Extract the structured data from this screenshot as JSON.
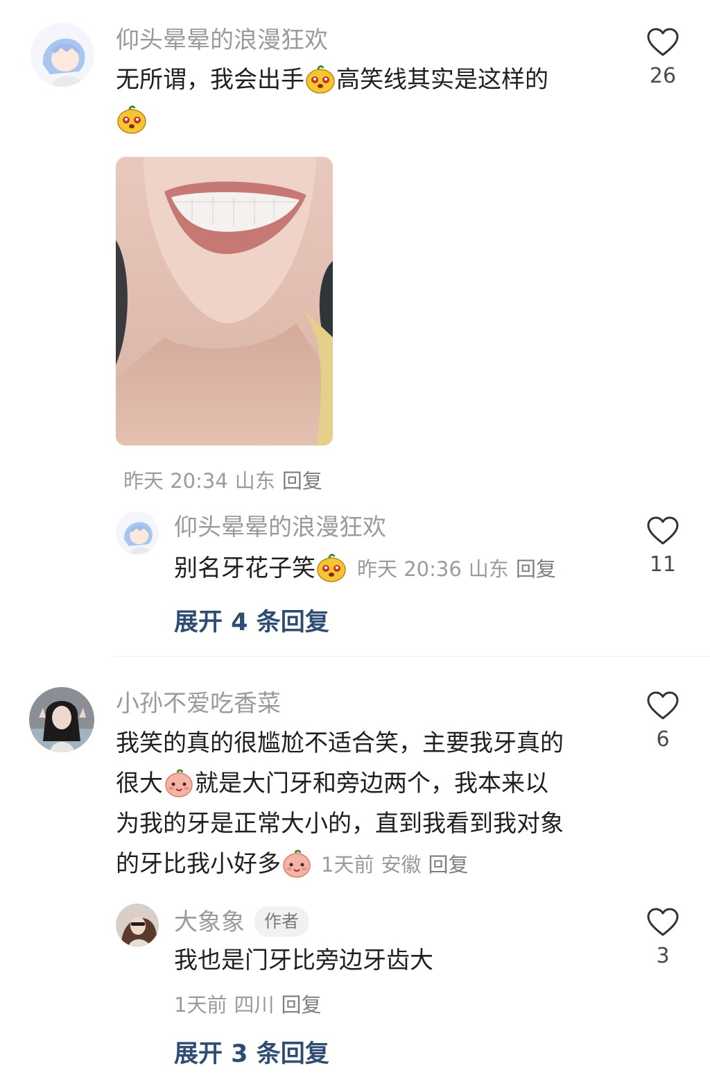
{
  "colors": {
    "username": "#9a9a9a",
    "text": "#1f1f1f",
    "meta": "#9b9b9b",
    "expand_link": "#2f4d73",
    "like_icon": "#333333"
  },
  "comments": [
    {
      "username": "仰头晕晕的浪漫狂欢",
      "text_line1_a": "无所谓，我会出手",
      "text_line1_b": "高笑线其实是这样的",
      "text_line2": "",
      "emoji": "yellow-bear-emoji",
      "has_image": true,
      "image_description_icon": "smile-photo",
      "time": "昨天 20:34",
      "location": "山东",
      "reply_label": "回复",
      "likes": "26",
      "replies": [
        {
          "username": "仰头晕晕的浪漫狂欢",
          "text": "别名牙花子笑",
          "emoji": "yellow-bear-emoji",
          "time": "昨天 20:36",
          "location": "山东",
          "reply_label": "回复",
          "likes": "11"
        }
      ],
      "expand_label": "展开 4 条回复"
    },
    {
      "username": "小孙不爱吃香菜",
      "line1": "我笑的真的很尴尬不适合笑，主要我牙真的",
      "line2_a": "很大",
      "line2_b": "就是大门牙和旁边两个，我本来以",
      "line3": "为我的牙是正常大小的，直到我看到我对象",
      "line4": "的牙比我小好多",
      "emoji": "peach-face-emoji",
      "time": "1天前",
      "location": "安徽",
      "reply_label": "回复",
      "likes": "6",
      "replies": [
        {
          "username": "大象象",
          "badge": "作者",
          "text": "我也是门牙比旁边牙齿大",
          "time": "1天前",
          "location": "四川",
          "reply_label": "回复",
          "likes": "3"
        }
      ],
      "expand_label": "展开 3 条回复"
    }
  ]
}
